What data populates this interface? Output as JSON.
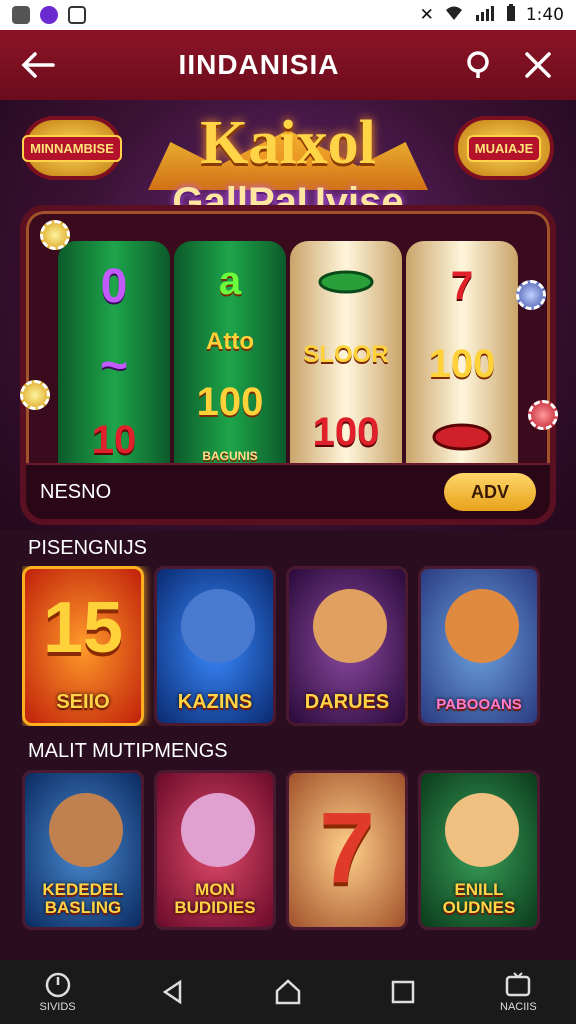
{
  "status_bar": {
    "time": "1:40"
  },
  "app_bar": {
    "title": "IINDANISIA"
  },
  "hero": {
    "badge_left": "MINNAMBISE",
    "badge_right": "MUAIAJE",
    "title": "Kaixol",
    "subtitle": "GallPaUvise",
    "reels": [
      [
        "0",
        "~",
        "10"
      ],
      [
        "a",
        "Atto",
        "100",
        "BAGUNIS"
      ],
      [
        "SLOOR",
        "100"
      ],
      [
        "7",
        "100"
      ]
    ],
    "bottom_label": "NESNO",
    "action_button": "ADV"
  },
  "section1": {
    "title": "PISENGNIJS",
    "tiles": [
      {
        "label": "SEIIO",
        "big": "15",
        "bg": "#e05a10"
      },
      {
        "label": "KAZINS",
        "bg": "#1a4aa0"
      },
      {
        "label": "DARUES",
        "bg": "#5a2a6a"
      },
      {
        "label": "PABOOANS",
        "bg": "#3a6ab0"
      }
    ]
  },
  "section2": {
    "title": "MALIT MUTIPMENGS",
    "tiles": [
      {
        "label": "KEDEDEL BASLING",
        "bg": "#1a5ab0"
      },
      {
        "label": "MON BUDIDIES",
        "bg": "#b01a3a"
      },
      {
        "label": "",
        "big": "7",
        "bg": "#c07a3a"
      },
      {
        "label": "ENILL OUDNES",
        "bg": "#1a7a3a"
      }
    ]
  },
  "nav": {
    "left_label": "SIVIDS",
    "right_label": "NACIIS"
  },
  "colors": {
    "accent": "#ffd447",
    "app_bar": "#8c1426",
    "background": "#2a0d1f"
  }
}
